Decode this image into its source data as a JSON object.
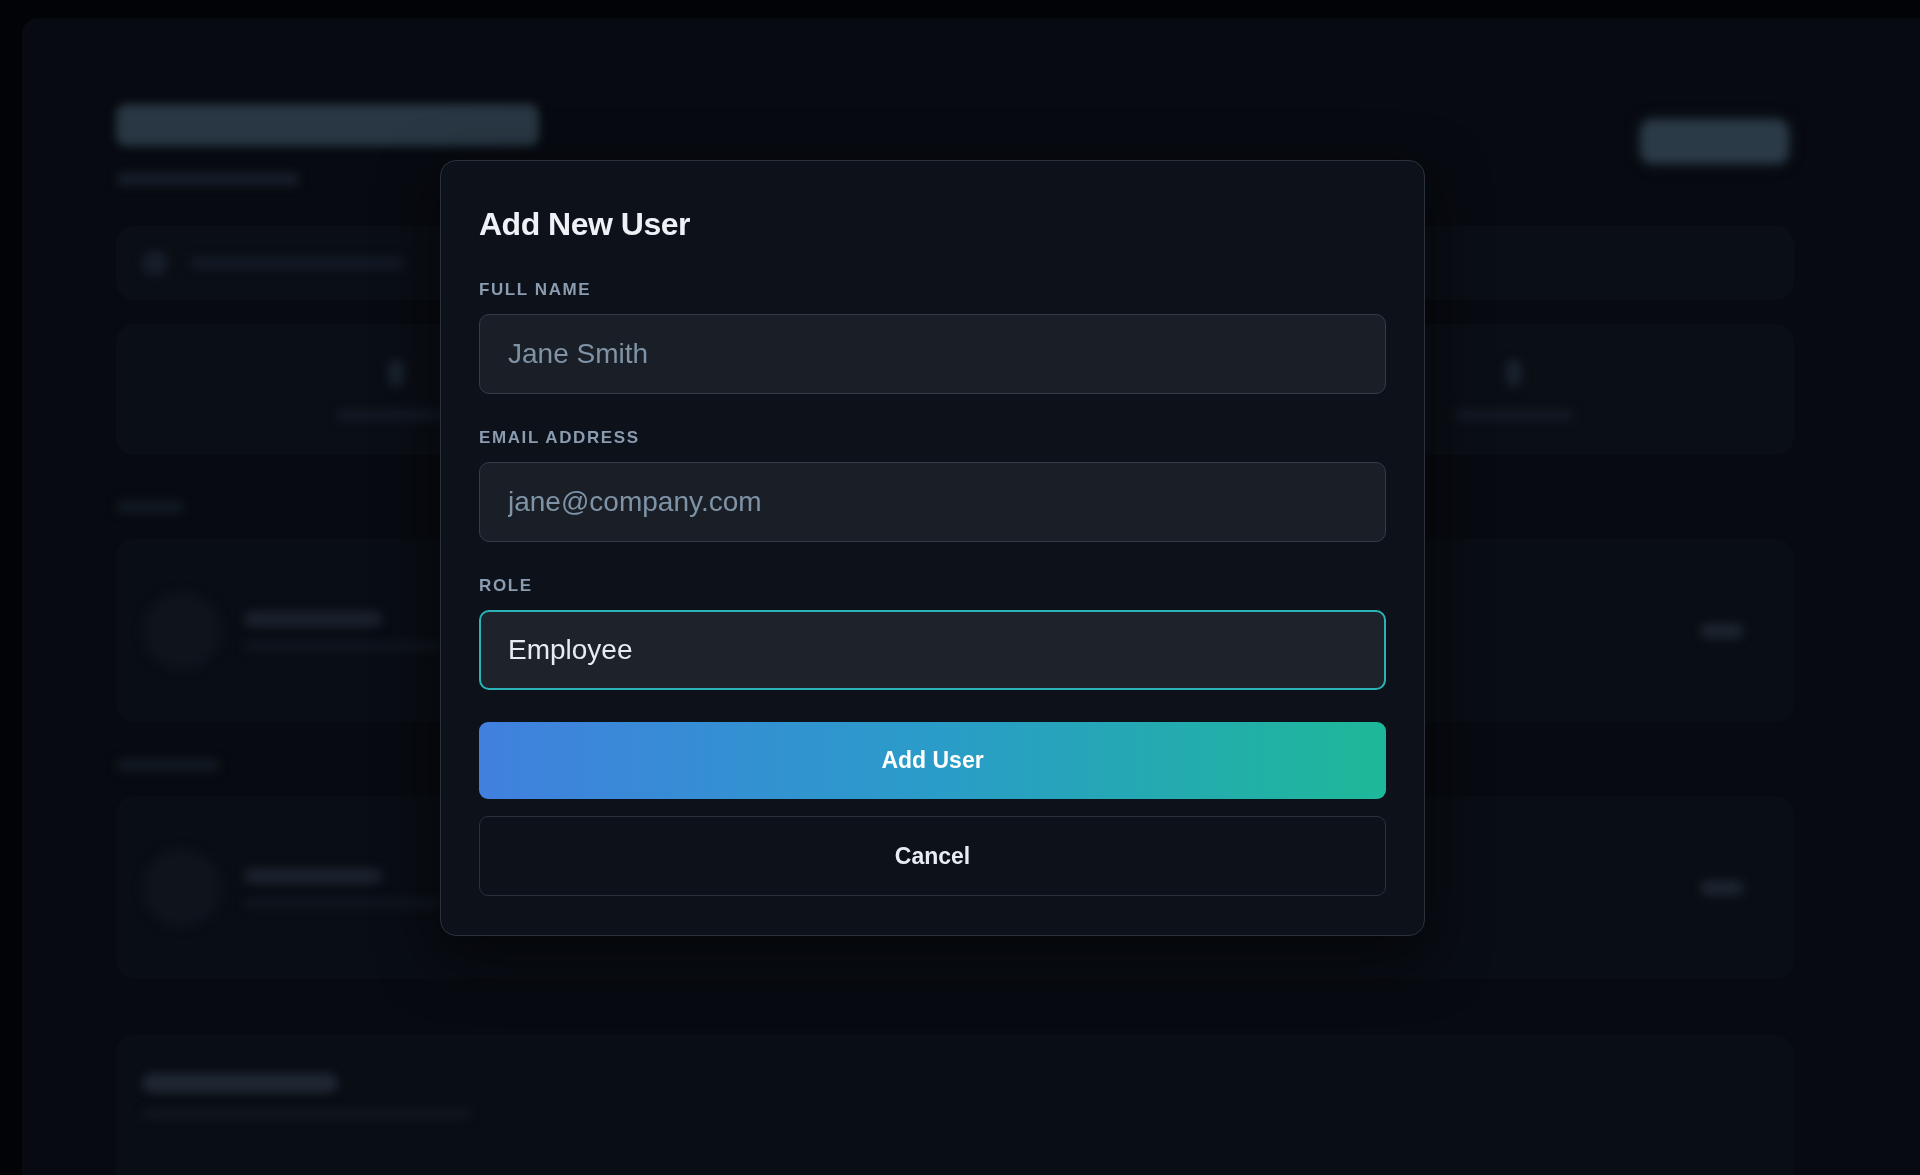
{
  "dialog": {
    "title": "Add New User",
    "fields": [
      {
        "label": "FULL NAME",
        "placeholder": "Jane Smith",
        "focused": false
      },
      {
        "label": "EMAIL ADDRESS",
        "placeholder": "jane@company.com",
        "focused": false
      },
      {
        "label": "ROLE",
        "value": "Employee",
        "focused": true
      }
    ],
    "buttons": [
      {
        "label": "Add User",
        "kind": "primary"
      },
      {
        "label": "Cancel",
        "kind": "secondary"
      }
    ]
  }
}
